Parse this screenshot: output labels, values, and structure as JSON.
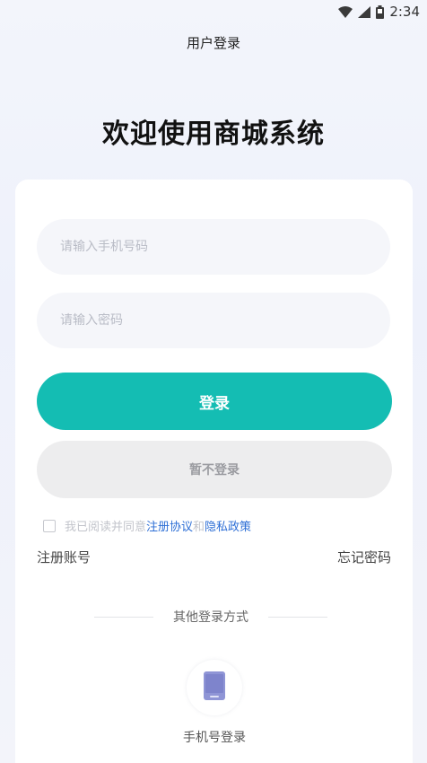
{
  "status_bar": {
    "time": "2:34",
    "icons": [
      "wifi-icon",
      "signal-icon",
      "battery-icon"
    ]
  },
  "header": {
    "title": "用户登录"
  },
  "welcome": {
    "text": "欢迎使用商城系统"
  },
  "form": {
    "phone_placeholder": "请输入手机号码",
    "phone_value": "",
    "password_placeholder": "请输入密码",
    "password_value": "",
    "login_label": "登录",
    "skip_label": "暂不登录"
  },
  "agreement": {
    "checked": false,
    "prefix": "我已阅读并同意",
    "terms_link": "注册协议",
    "connector": "和",
    "privacy_link": "隐私政策"
  },
  "links": {
    "register": "注册账号",
    "forgot": "忘记密码"
  },
  "other_login": {
    "heading": "其他登录方式",
    "methods": [
      {
        "icon": "phone-icon",
        "label": "手机号登录"
      }
    ]
  },
  "colors": {
    "primary": "#14bdb3",
    "link": "#2e6fd6",
    "disabled_button": "#ededee",
    "input_bg": "#f5f6fa",
    "phone_icon": "#8f95d6"
  }
}
